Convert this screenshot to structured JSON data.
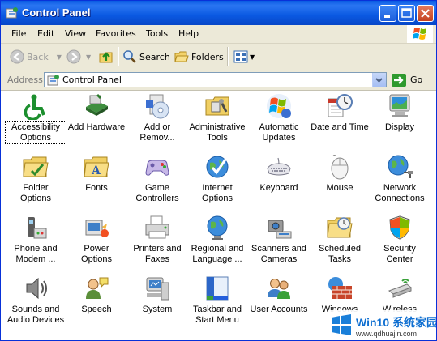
{
  "window": {
    "title": "Control Panel",
    "title_icon": "control-panel-icon",
    "buttons": [
      "minimize",
      "maximize",
      "close"
    ]
  },
  "menu": [
    "File",
    "Edit",
    "View",
    "Favorites",
    "Tools",
    "Help"
  ],
  "toolbar": {
    "back_label": "Back",
    "search_label": "Search",
    "folders_label": "Folders"
  },
  "address": {
    "label": "Address",
    "value": "Control Panel",
    "go_label": "Go"
  },
  "items": [
    {
      "label": "Accessibility Options",
      "icon": "accessibility-icon",
      "selected": true
    },
    {
      "label": "Add Hardware",
      "icon": "add-hardware-icon"
    },
    {
      "label": "Add or Remov...",
      "icon": "add-remove-programs-icon"
    },
    {
      "label": "Administrative Tools",
      "icon": "administrative-tools-icon"
    },
    {
      "label": "Automatic Updates",
      "icon": "automatic-updates-icon"
    },
    {
      "label": "Date and Time",
      "icon": "date-time-icon"
    },
    {
      "label": "Display",
      "icon": "display-icon"
    },
    {
      "label": "Folder Options",
      "icon": "folder-options-icon"
    },
    {
      "label": "Fonts",
      "icon": "fonts-icon"
    },
    {
      "label": "Game Controllers",
      "icon": "game-controllers-icon"
    },
    {
      "label": "Internet Options",
      "icon": "internet-options-icon"
    },
    {
      "label": "Keyboard",
      "icon": "keyboard-icon"
    },
    {
      "label": "Mouse",
      "icon": "mouse-icon"
    },
    {
      "label": "Network Connections",
      "icon": "network-connections-icon"
    },
    {
      "label": "Phone and Modem ...",
      "icon": "phone-modem-icon"
    },
    {
      "label": "Power Options",
      "icon": "power-options-icon"
    },
    {
      "label": "Printers and Faxes",
      "icon": "printers-faxes-icon"
    },
    {
      "label": "Regional and Language ...",
      "icon": "regional-language-icon"
    },
    {
      "label": "Scanners and Cameras",
      "icon": "scanners-cameras-icon"
    },
    {
      "label": "Scheduled Tasks",
      "icon": "scheduled-tasks-icon"
    },
    {
      "label": "Security Center",
      "icon": "security-center-icon"
    },
    {
      "label": "Sounds and Audio Devices",
      "icon": "sounds-audio-icon"
    },
    {
      "label": "Speech",
      "icon": "speech-icon"
    },
    {
      "label": "System",
      "icon": "system-icon"
    },
    {
      "label": "Taskbar and Start Menu",
      "icon": "taskbar-start-menu-icon"
    },
    {
      "label": "User Accounts",
      "icon": "user-accounts-icon"
    },
    {
      "label": "Windows",
      "icon": "windows-firewall-icon"
    },
    {
      "label": "Wireless",
      "icon": "wireless-network-icon"
    }
  ],
  "watermark": {
    "title": "Win10 系统家园",
    "url": "www.qdhuajin.com"
  }
}
